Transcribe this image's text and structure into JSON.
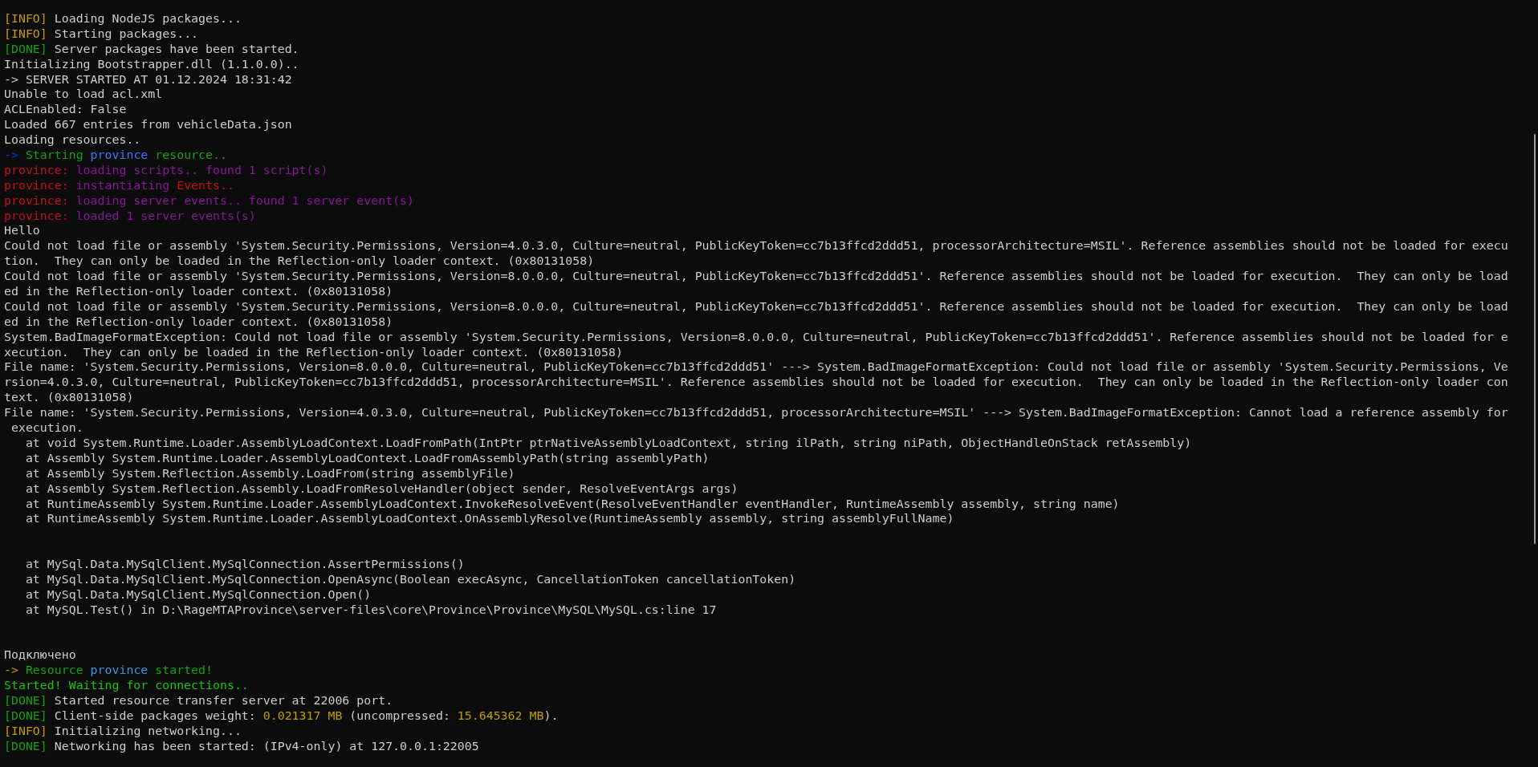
{
  "blocks": [
    {
      "lines": [
        {
          "segments": [
            {
              "text": "[INFO]",
              "color": "#c19c00"
            },
            {
              "text": " Loading NodeJS packages...",
              "color": "#cccccc"
            }
          ]
        },
        {
          "segments": [
            {
              "text": "[INFO]",
              "color": "#c19c00"
            },
            {
              "text": " Starting packages...",
              "color": "#cccccc"
            }
          ]
        },
        {
          "segments": [
            {
              "text": "[DONE]",
              "color": "#13a10e"
            },
            {
              "text": " Server packages have been started.",
              "color": "#cccccc"
            }
          ]
        },
        {
          "segments": [
            {
              "text": "Initializing Bootstrapper.dll (1.1.0.0)..",
              "color": "#cccccc"
            }
          ]
        },
        {
          "segments": [
            {
              "text": "-> SERVER STARTED AT 01.12.2024 18:31:42",
              "color": "#cccccc"
            }
          ]
        },
        {
          "segments": [
            {
              "text": "Unable to load acl.xml",
              "color": "#cccccc"
            }
          ]
        },
        {
          "segments": [
            {
              "text": "ACLEnabled: False",
              "color": "#cccccc"
            }
          ]
        },
        {
          "segments": [
            {
              "text": "Loaded 667 entries from vehicleData.json",
              "color": "#cccccc"
            }
          ]
        },
        {
          "segments": [
            {
              "text": "Loading resources..",
              "color": "#cccccc"
            }
          ]
        },
        {
          "segments": [
            {
              "text": "-> ",
              "color": "#0037da"
            },
            {
              "text": "Starting ",
              "color": "#13a10e"
            },
            {
              "text": "province",
              "color": "#3b78ff"
            },
            {
              "text": " resource..",
              "color": "#13a10e"
            }
          ]
        },
        {
          "segments": [
            {
              "text": "province:",
              "color": "#c50f1f"
            },
            {
              "text": " loading scripts.. found 1 script(s)",
              "color": "#881798"
            }
          ]
        },
        {
          "segments": [
            {
              "text": "province:",
              "color": "#c50f1f"
            },
            {
              "text": " instantiating ",
              "color": "#881798"
            },
            {
              "text": "Events..",
              "color": "#c50f1f"
            }
          ]
        },
        {
          "segments": [
            {
              "text": "province:",
              "color": "#c50f1f"
            },
            {
              "text": " loading server events.. found 1 server event(s)",
              "color": "#881798"
            }
          ]
        },
        {
          "segments": [
            {
              "text": "province:",
              "color": "#c50f1f"
            },
            {
              "text": " loaded 1 server events(s)",
              "color": "#881798"
            }
          ]
        },
        {
          "segments": [
            {
              "text": "Hello",
              "color": "#cccccc"
            }
          ]
        },
        {
          "segments": [
            {
              "text": "Could not load file or assembly 'System.Security.Permissions, Version=4.0.3.0, Culture=neutral, PublicKeyToken=cc7b13ffcd2ddd51, processorArchitecture=MSIL'. Reference assemblies should not be loaded for execu",
              "color": "#cccccc"
            }
          ]
        },
        {
          "segments": [
            {
              "text": "tion.  They can only be loaded in the Reflection-only loader context. (0x80131058)",
              "color": "#cccccc"
            }
          ]
        },
        {
          "segments": [
            {
              "text": "Could not load file or assembly 'System.Security.Permissions, Version=8.0.0.0, Culture=neutral, PublicKeyToken=cc7b13ffcd2ddd51'. Reference assemblies should not be loaded for execution.  They can only be load",
              "color": "#cccccc"
            }
          ]
        },
        {
          "segments": [
            {
              "text": "ed in the Reflection-only loader context. (0x80131058)",
              "color": "#cccccc"
            }
          ]
        },
        {
          "segments": [
            {
              "text": "Could not load file or assembly 'System.Security.Permissions, Version=8.0.0.0, Culture=neutral, PublicKeyToken=cc7b13ffcd2ddd51'. Reference assemblies should not be loaded for execution.  They can only be load",
              "color": "#cccccc"
            }
          ]
        },
        {
          "segments": [
            {
              "text": "ed in the Reflection-only loader context. (0x80131058)",
              "color": "#cccccc"
            }
          ]
        },
        {
          "segments": [
            {
              "text": "System.BadImageFormatException: Could not load file or assembly 'System.Security.Permissions, Version=8.0.0.0, Culture=neutral, PublicKeyToken=cc7b13ffcd2ddd51'. Reference assemblies should not be loaded for e",
              "color": "#cccccc"
            }
          ]
        },
        {
          "segments": [
            {
              "text": "xecution.  They can only be loaded in the Reflection-only loader context. (0x80131058)",
              "color": "#cccccc"
            }
          ]
        },
        {
          "segments": [
            {
              "text": "File name: 'System.Security.Permissions, Version=8.0.0.0, Culture=neutral, PublicKeyToken=cc7b13ffcd2ddd51' ---> System.BadImageFormatException: Could not load file or assembly 'System.Security.Permissions, Ve",
              "color": "#cccccc"
            }
          ]
        },
        {
          "segments": [
            {
              "text": "rsion=4.0.3.0, Culture=neutral, PublicKeyToken=cc7b13ffcd2ddd51, processorArchitecture=MSIL'. Reference assemblies should not be loaded for execution.  They can only be loaded in the Reflection-only loader con",
              "color": "#cccccc"
            }
          ]
        },
        {
          "segments": [
            {
              "text": "text. (0x80131058)",
              "color": "#cccccc"
            }
          ]
        },
        {
          "segments": [
            {
              "text": "File name: 'System.Security.Permissions, Version=4.0.3.0, Culture=neutral, PublicKeyToken=cc7b13ffcd2ddd51, processorArchitecture=MSIL' ---> System.BadImageFormatException: Cannot load a reference assembly for",
              "color": "#cccccc"
            }
          ]
        },
        {
          "segments": [
            {
              "text": " execution.",
              "color": "#cccccc"
            }
          ]
        },
        {
          "segments": [
            {
              "text": "   at void System.Runtime.Loader.AssemblyLoadContext.LoadFromPath(IntPtr ptrNativeAssemblyLoadContext, string ilPath, string niPath, ObjectHandleOnStack retAssembly)",
              "color": "#cccccc"
            }
          ]
        },
        {
          "segments": [
            {
              "text": "   at Assembly System.Runtime.Loader.AssemblyLoadContext.LoadFromAssemblyPath(string assemblyPath)",
              "color": "#cccccc"
            }
          ]
        },
        {
          "segments": [
            {
              "text": "   at Assembly System.Reflection.Assembly.LoadFrom(string assemblyFile)",
              "color": "#cccccc"
            }
          ]
        },
        {
          "segments": [
            {
              "text": "   at Assembly System.Reflection.Assembly.LoadFromResolveHandler(object sender, ResolveEventArgs args)",
              "color": "#cccccc"
            }
          ]
        },
        {
          "segments": [
            {
              "text": "   at RuntimeAssembly System.Runtime.Loader.AssemblyLoadContext.InvokeResolveEvent(ResolveEventHandler eventHandler, RuntimeAssembly assembly, string name)",
              "color": "#cccccc"
            }
          ]
        },
        {
          "segments": [
            {
              "text": "   at RuntimeAssembly System.Runtime.Loader.AssemblyLoadContext.OnAssemblyResolve(RuntimeAssembly assembly, string assemblyFullName)",
              "color": "#cccccc"
            }
          ]
        }
      ]
    },
    {
      "lines": [
        {
          "segments": [
            {
              "text": "   at MySql.Data.MySqlClient.MySqlConnection.AssertPermissions()",
              "color": "#cccccc"
            }
          ]
        },
        {
          "segments": [
            {
              "text": "   at MySql.Data.MySqlClient.MySqlConnection.OpenAsync(Boolean execAsync, CancellationToken cancellationToken)",
              "color": "#cccccc"
            }
          ]
        },
        {
          "segments": [
            {
              "text": "   at MySql.Data.MySqlClient.MySqlConnection.Open()",
              "color": "#cccccc"
            }
          ]
        },
        {
          "segments": [
            {
              "text": "   at MySQL.Test() in D:\\RageMTAProvince\\server-files\\core\\Province\\Province\\MySQL\\MySQL.cs:line 17",
              "color": "#cccccc"
            }
          ]
        }
      ]
    },
    {
      "lines": [
        {
          "segments": [
            {
              "text": "Подключено",
              "color": "#cccccc"
            }
          ]
        },
        {
          "segments": [
            {
              "text": "-> ",
              "color": "#c19c00"
            },
            {
              "text": "Resource ",
              "color": "#13a10e"
            },
            {
              "text": "province",
              "color": "#3a96dd"
            },
            {
              "text": " started!",
              "color": "#13a10e"
            }
          ]
        },
        {
          "segments": [
            {
              "text": "Started! Waiting for connections..",
              "color": "#16c60c"
            }
          ]
        },
        {
          "segments": [
            {
              "text": "[DONE]",
              "color": "#13a10e"
            },
            {
              "text": " Started resource transfer server at 22006 port.",
              "color": "#cccccc"
            }
          ]
        },
        {
          "segments": [
            {
              "text": "[DONE]",
              "color": "#13a10e"
            },
            {
              "text": " Client-side packages weight: ",
              "color": "#cccccc"
            },
            {
              "text": "0.021317 MB",
              "color": "#c19c00"
            },
            {
              "text": " (uncompressed: ",
              "color": "#cccccc"
            },
            {
              "text": "15.645362 MB",
              "color": "#c19c00"
            },
            {
              "text": ").",
              "color": "#cccccc"
            }
          ]
        },
        {
          "segments": [
            {
              "text": "[INFO]",
              "color": "#c19c00"
            },
            {
              "text": " Initializing networking...",
              "color": "#cccccc"
            }
          ]
        },
        {
          "segments": [
            {
              "text": "[DONE]",
              "color": "#13a10e"
            },
            {
              "text": " Networking has been started: (IPv4-only) at 127.0.0.1:22005",
              "color": "#cccccc"
            }
          ]
        }
      ]
    }
  ]
}
